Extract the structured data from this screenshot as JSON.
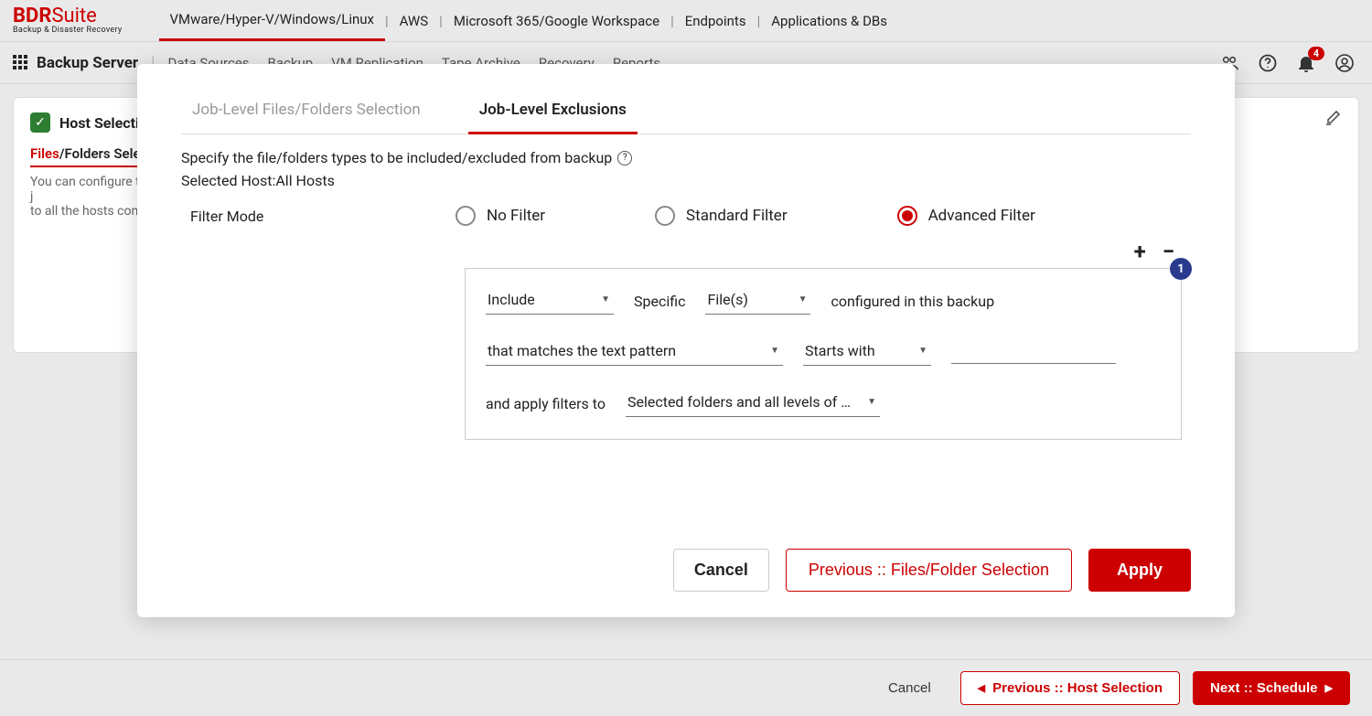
{
  "logo": {
    "brand_left": "BDR",
    "brand_right": "Suite",
    "tagline": "Backup & Disaster Recovery"
  },
  "topnav": {
    "items": [
      "VMware/Hyper-V/Windows/Linux",
      "AWS",
      "Microsoft 365/Google Workspace",
      "Endpoints",
      "Applications & DBs"
    ],
    "active_index": 0
  },
  "subbar": {
    "title": "Backup Server",
    "items": [
      "Data Sources",
      "Backup",
      "VM Replication",
      "Tape Archive",
      "Recovery",
      "Reports"
    ],
    "notifications": "4"
  },
  "page": {
    "step_title": "Host Selection",
    "tab_label_prefix": "Files",
    "tab_label_rest": "/Folders Select",
    "description": "You can configure the job level... to all the hosts configured in this backup."
  },
  "page_footer": {
    "cancel": "Cancel",
    "previous": "Previous :: Host Selection",
    "next": "Next :: Schedule"
  },
  "modal": {
    "tabs": [
      "Job-Level Files/Folders Selection",
      "Job-Level Exclusions"
    ],
    "active_tab": 1,
    "description": "Specify the file/folders types to be included/excluded from backup",
    "selected_host_label": "Selected Host:",
    "selected_host_value": "All Hosts",
    "filter_mode_label": "Filter Mode",
    "filter_options": [
      "No Filter",
      "Standard Filter",
      "Advanced Filter"
    ],
    "filter_selected_index": 2,
    "rule": {
      "badge": "1",
      "include_exclude": "Include",
      "specific_label": "Specific",
      "target": "File(s)",
      "configured_text": "configured in this backup",
      "match_type": "that matches the text pattern",
      "operator": "Starts with",
      "value": "",
      "apply_label": "and apply filters to",
      "apply_scope": "Selected folders and all levels of subf…"
    },
    "footer": {
      "cancel": "Cancel",
      "previous": "Previous :: Files/Folder Selection",
      "apply": "Apply"
    }
  }
}
